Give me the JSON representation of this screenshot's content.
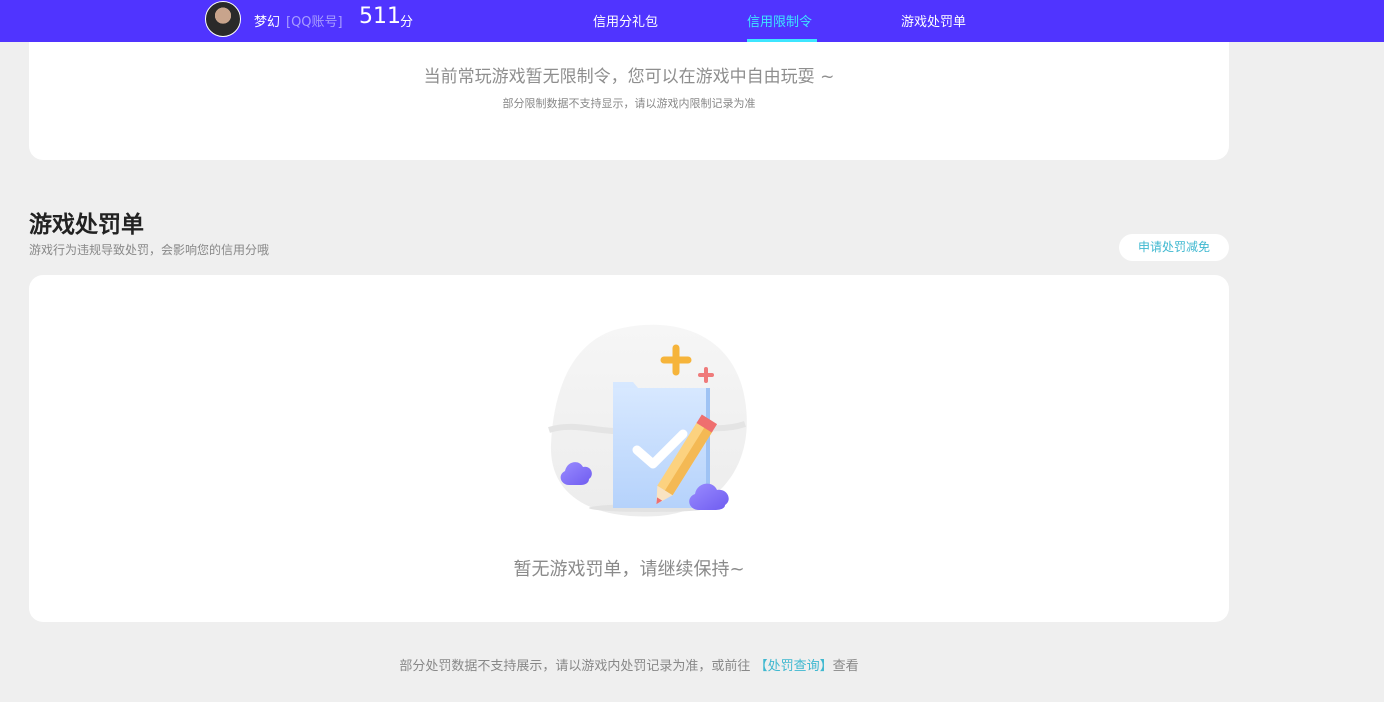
{
  "header": {
    "username": "梦幻",
    "account_type": "[QQ账号]",
    "score": "511",
    "score_unit": "分",
    "nav": [
      "信用分礼包",
      "信用限制令",
      "游戏处罚单"
    ],
    "active_tab": "信用限制令"
  },
  "restriction": {
    "empty_message": "当前常玩游戏暂无限制令，您可以在游戏中自由玩耍 ~",
    "note": "部分限制数据不支持显示，请以游戏内限制记录为准"
  },
  "penalty": {
    "title": "游戏处罚单",
    "subtitle": "游戏行为违规导致处罚，会影响您的信用分哦",
    "apply_button": "申请处罚减免",
    "empty_message": "暂无游戏罚单，请继续保持~"
  },
  "footer": {
    "text_before": "部分处罚数据不支持展示，请以游戏内处罚记录为准，或前往",
    "link": "【处罚查询】",
    "text_after": "查看"
  },
  "colors": {
    "header_bg": "#5034ff",
    "active_tab": "#3ee6ff",
    "link": "#3fb8d0",
    "page_bg": "#efefef"
  },
  "icons": {
    "avatar": "user-avatar",
    "empty_illustration": "folder-check-pencil-illustration"
  }
}
